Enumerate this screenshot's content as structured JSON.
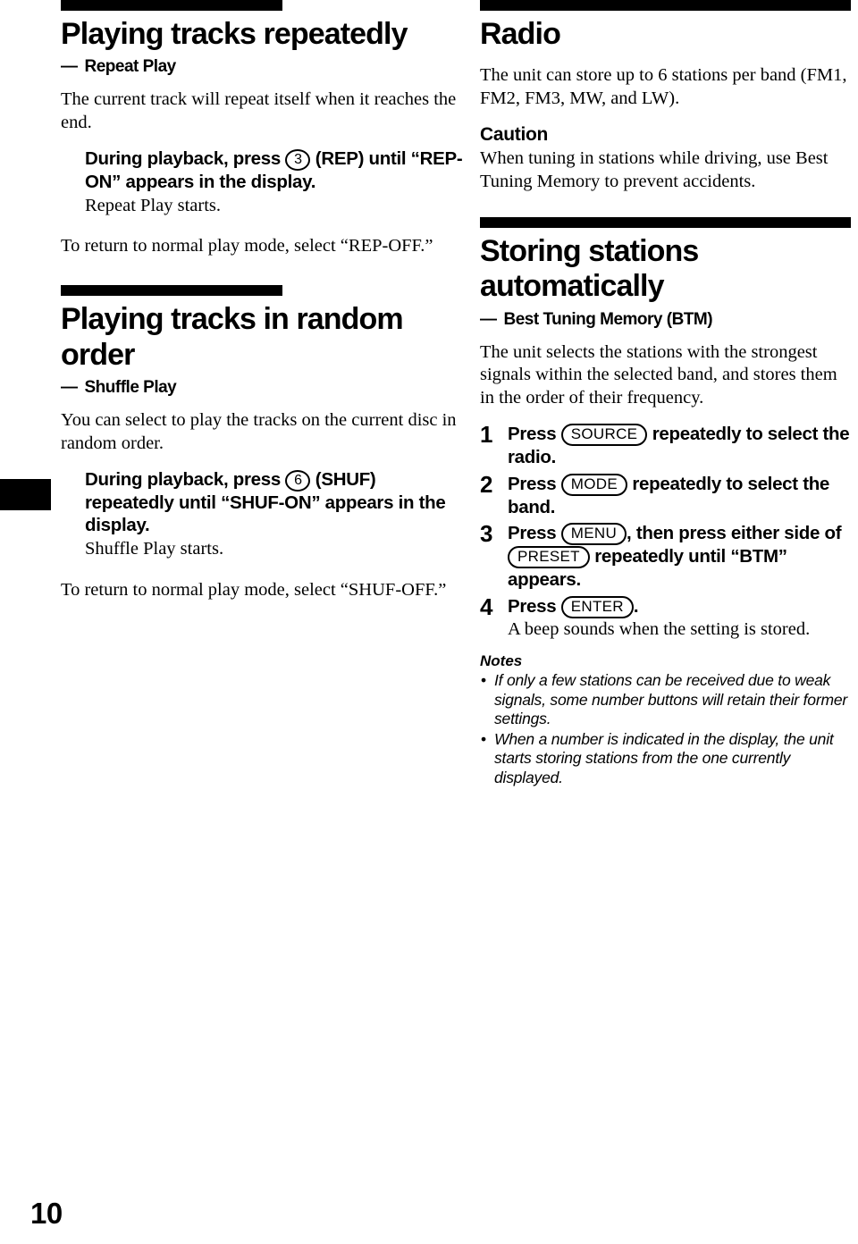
{
  "page": {
    "number": "10",
    "edge_tab": "section-thumb-index-marker"
  },
  "left_column": {
    "sections": [
      {
        "title": "Playing tracks repeatedly",
        "subtitle_dash": "—",
        "subtitle": "Repeat Play",
        "intro": "The current track will repeat itself when it reaches the end.",
        "instruction_prefix": "During playback, press",
        "instruction_button": "3",
        "instruction_suffix": "(REP) until “REP-ON” appears in the display.",
        "instruction_result": "Repeat Play starts.",
        "closing": "To return to normal play mode, select “REP-OFF.”"
      },
      {
        "title": "Playing tracks in random order",
        "subtitle_dash": "—",
        "subtitle": "Shuffle Play",
        "intro": "You can select to play the tracks on the current disc in random order.",
        "instruction_prefix": "During playback, press",
        "instruction_button": "6",
        "instruction_suffix": "(SHUF) repeatedly until “SHUF-ON” appears in the display.",
        "instruction_result": "Shuffle Play starts.",
        "closing": "To return to normal play mode, select “SHUF-OFF.”"
      }
    ]
  },
  "right_column": {
    "radio": {
      "title": "Radio",
      "intro": "The unit can store up to 6 stations per band (FM1, FM2, FM3, MW, and LW).",
      "caution_title": "Caution",
      "caution_text": "When tuning in stations while driving, use Best Tuning Memory to prevent accidents."
    },
    "storing": {
      "title": "Storing stations automatically",
      "subtitle_dash": "—",
      "subtitle": "Best Tuning Memory (BTM)",
      "intro": "The unit selects the stations with the strongest signals within the selected band, and stores them in the order of their frequency.",
      "steps": [
        {
          "number": "1",
          "text_before": "Press",
          "button": "SOURCE",
          "text_after": "repeatedly to select the radio.",
          "extra_button": null,
          "text_tail": null,
          "result": null
        },
        {
          "number": "2",
          "text_before": "Press",
          "button": "MODE",
          "text_after": "repeatedly to select the band.",
          "extra_button": null,
          "text_tail": null,
          "result": null
        },
        {
          "number": "3",
          "text_before": "Press",
          "button": "MENU",
          "text_after": ", then press either side of",
          "extra_button": "PRESET",
          "text_tail": "repeatedly until “BTM” appears.",
          "result": null
        },
        {
          "number": "4",
          "text_before": "Press",
          "button": "ENTER",
          "text_after": ".",
          "extra_button": null,
          "text_tail": null,
          "result": "A beep sounds when the setting is stored."
        }
      ],
      "notes_title": "Notes",
      "notes": [
        "If only a few stations can be received due to weak signals, some number buttons will retain their former settings.",
        "When a number is indicated in the display, the unit starts storing stations from the one currently displayed."
      ]
    }
  },
  "colors": {
    "ink": "#000000",
    "paper": "#ffffff"
  }
}
